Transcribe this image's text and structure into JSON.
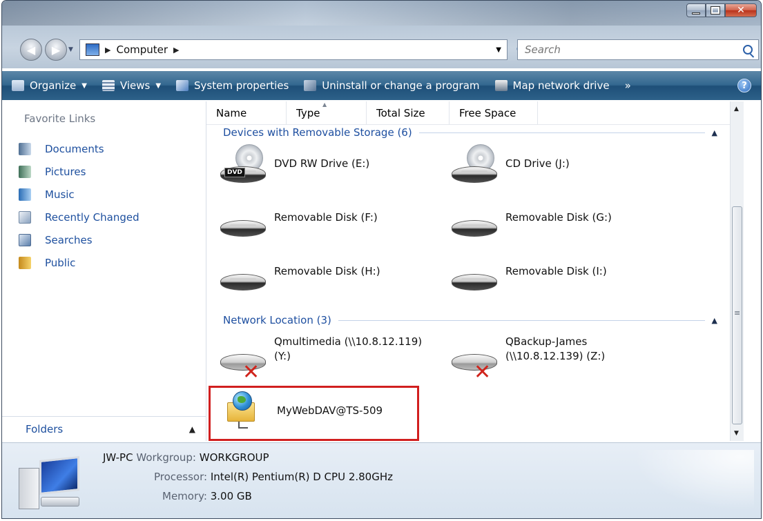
{
  "address": {
    "crumbs": [
      "Computer"
    ]
  },
  "search": {
    "placeholder": "Search"
  },
  "toolbar": {
    "organize": "Organize",
    "views": "Views",
    "system_properties": "System properties",
    "uninstall": "Uninstall or change a program",
    "map_drive": "Map network drive",
    "more": "»",
    "help": "?"
  },
  "sidebar": {
    "title": "Favorite Links",
    "items": [
      {
        "label": "Documents",
        "icon": "documents-icon",
        "color": "#6b8fb8"
      },
      {
        "label": "Pictures",
        "icon": "pictures-icon",
        "color": "#5a8a6e"
      },
      {
        "label": "Music",
        "icon": "music-icon",
        "color": "#3f84c9"
      },
      {
        "label": "Recently Changed",
        "icon": "recently-changed-icon",
        "color": "#8fa6c0"
      },
      {
        "label": "Searches",
        "icon": "searches-icon",
        "color": "#7d9bc2"
      },
      {
        "label": "Public",
        "icon": "public-folder-icon",
        "color": "#e3b23c"
      }
    ],
    "folders_label": "Folders"
  },
  "columns": [
    "Name",
    "Type",
    "Total Size",
    "Free Space"
  ],
  "groups": {
    "removable": "Devices with Removable Storage (6)",
    "network": "Network Location (3)"
  },
  "items": {
    "dvd": "DVD RW Drive (E:)",
    "cd": "CD Drive (J:)",
    "f": "Removable Disk (F:)",
    "g": "Removable Disk (G:)",
    "h": "Removable Disk (H:)",
    "i": "Removable Disk (I:)",
    "qmulti_1": "Qmultimedia (\\\\10.8.12.119)",
    "qmulti_2": "(Y:)",
    "qbackup_1": "QBackup-James",
    "qbackup_2": "(\\\\10.8.12.139) (Z:)",
    "webdav": "MyWebDAV@TS-509"
  },
  "dvd_badge": "DVD",
  "details": {
    "computer_name": "JW-PC",
    "workgroup_label": "Workgroup:",
    "workgroup_value": "WORKGROUP",
    "processor_label": "Processor:",
    "processor_value": "Intel(R) Pentium(R) D CPU 2.80GHz",
    "memory_label": "Memory:",
    "memory_value": "3.00 GB"
  },
  "colors": {
    "highlight": "#d11f1f",
    "link": "#1d4f9e",
    "group_header": "#1e4fa0"
  }
}
